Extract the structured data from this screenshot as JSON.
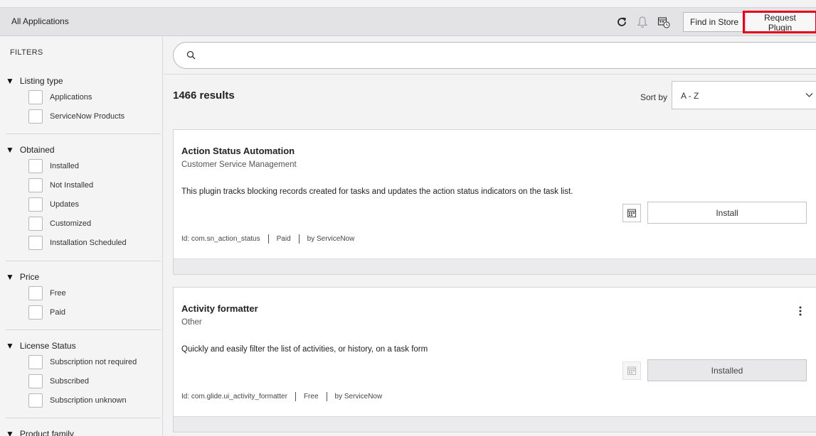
{
  "header": {
    "title": "All Applications",
    "find_in_store": "Find in Store",
    "request_plugin": "Request Plugin"
  },
  "filters": {
    "title": "FILTERS",
    "groups": [
      {
        "label": "Listing type",
        "options": [
          "Applications",
          "ServiceNow Products"
        ]
      },
      {
        "label": "Obtained",
        "options": [
          "Installed",
          "Not Installed",
          "Updates",
          "Customized",
          "Installation Scheduled"
        ]
      },
      {
        "label": "Price",
        "options": [
          "Free",
          "Paid"
        ]
      },
      {
        "label": "License Status",
        "options": [
          "Subscription not required",
          "Subscribed",
          "Subscription unknown"
        ]
      },
      {
        "label": "Product family",
        "options": []
      }
    ]
  },
  "search": {
    "placeholder": ""
  },
  "results": {
    "count_text": "1466 results",
    "sort_label": "Sort by",
    "sort_value": "A - Z"
  },
  "cards": [
    {
      "name": "Action Status Automation",
      "category": "Customer Service Management",
      "description": "This plugin tracks blocking records created for tasks and updates the action status indicators on the task list.",
      "action_label": "Install",
      "id_text": "Id: com.sn_action_status",
      "price": "Paid",
      "vendor": "by ServiceNow"
    },
    {
      "name": "Activity formatter",
      "category": "Other",
      "description": "Quickly and easily filter the list of activities, or history, on a task form",
      "action_label": "Installed",
      "id_text": "Id: com.glide.ui_activity_formatter",
      "price": "Free",
      "vendor": "by ServiceNow"
    }
  ],
  "colors": {
    "highlight": "#e3001b",
    "header_bg": "#e3e3e6"
  },
  "icons": [
    "refresh-icon",
    "bell-icon",
    "calendar-clock-icon",
    "search-icon",
    "chevron-down-icon",
    "calendar-grid-icon",
    "more-vertical-icon"
  ]
}
